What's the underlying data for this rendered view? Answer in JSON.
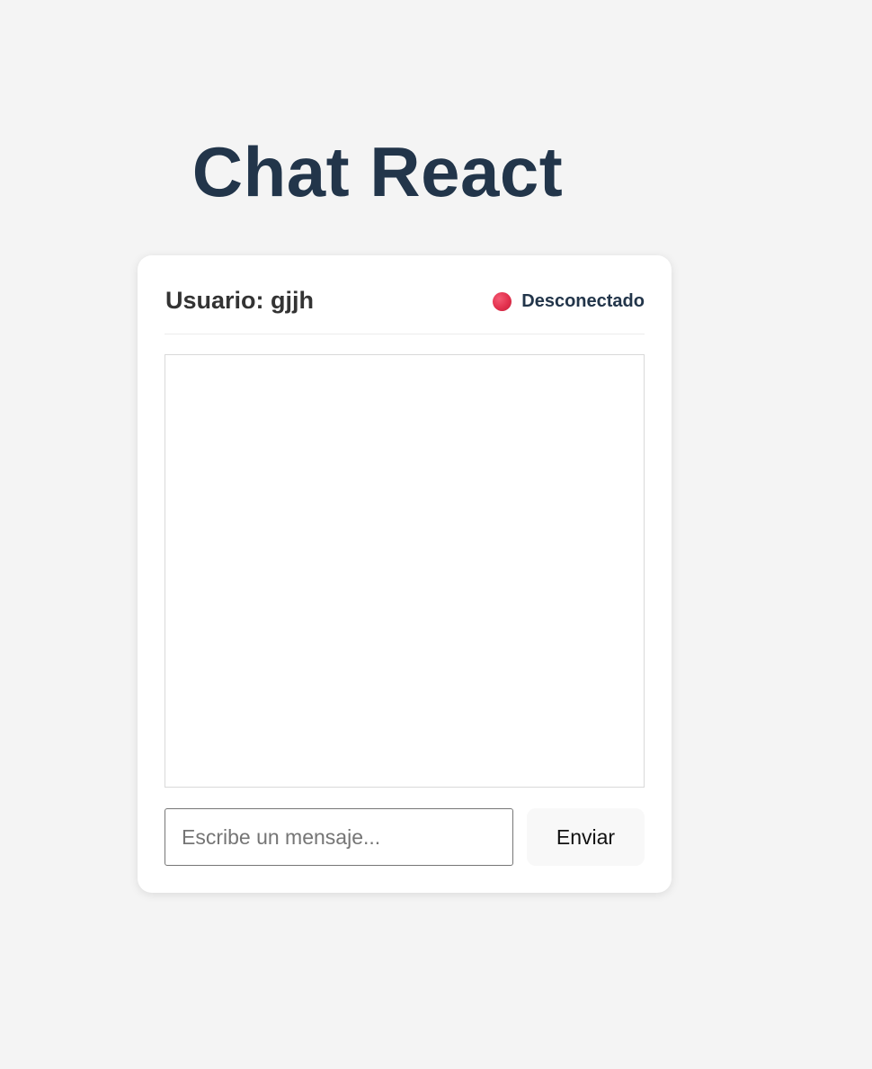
{
  "app": {
    "title": "Chat React"
  },
  "header": {
    "user_label": "Usuario: gjjh",
    "status": {
      "text": "Desconectado",
      "icon": "status-dot-icon",
      "color": "#e2304d"
    }
  },
  "messages": [],
  "composer": {
    "input_value": "",
    "input_placeholder": "Escribe un mensaje...",
    "send_label": "Enviar"
  }
}
